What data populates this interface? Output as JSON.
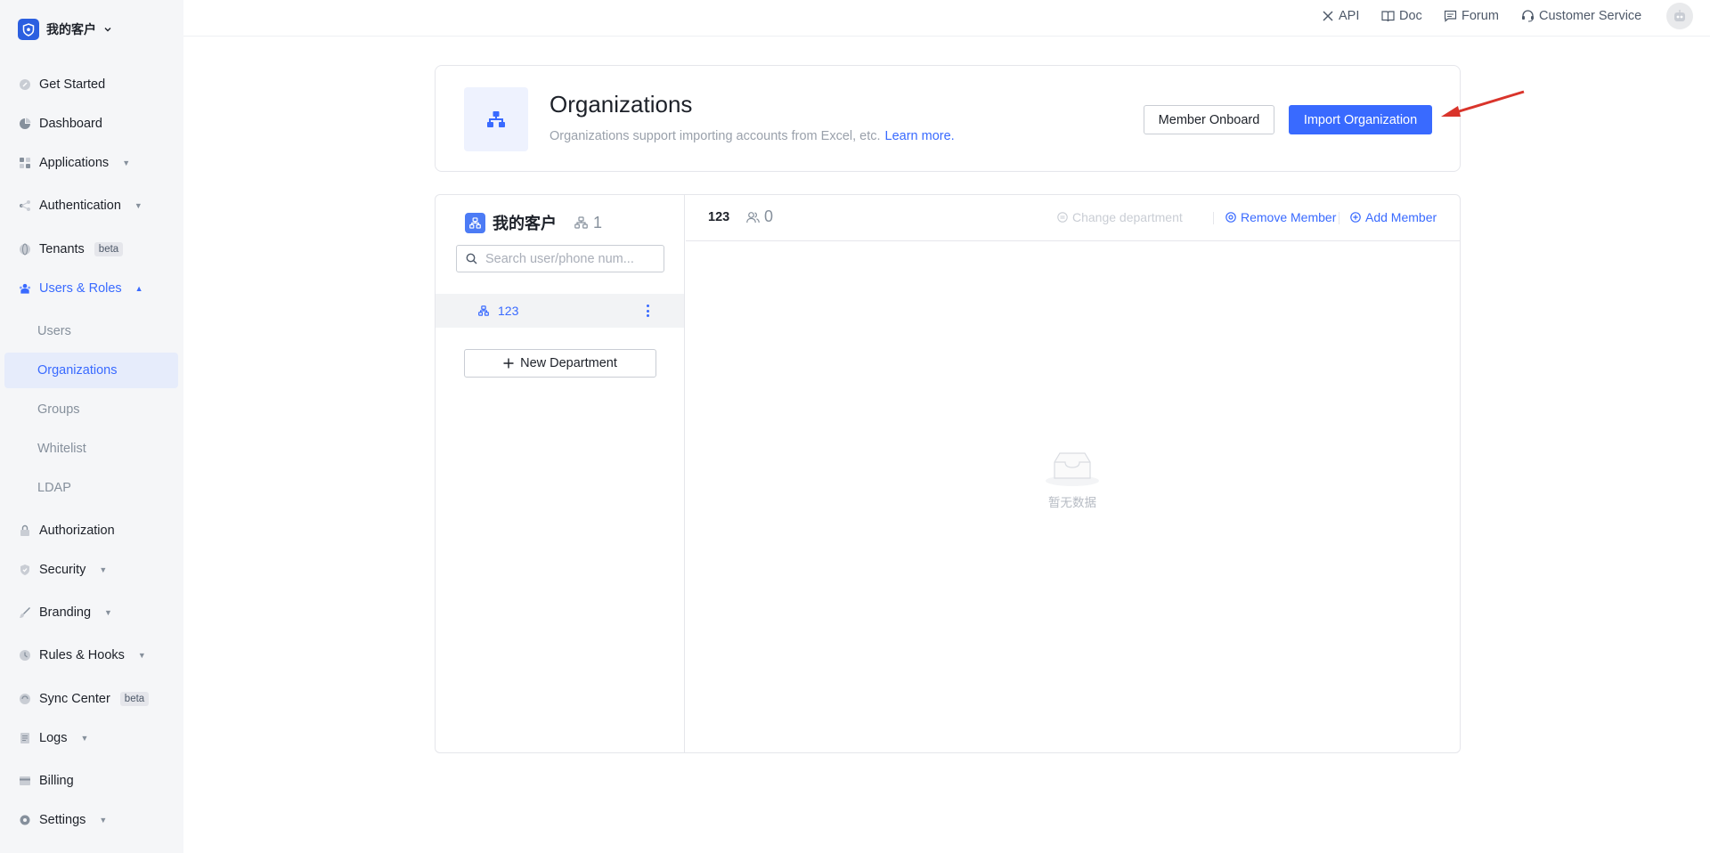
{
  "sidebar": {
    "brand": "我的客户",
    "items": [
      {
        "label": "Get Started"
      },
      {
        "label": "Dashboard"
      },
      {
        "label": "Applications"
      },
      {
        "label": "Authentication"
      },
      {
        "label": "Tenants",
        "badge": "beta"
      },
      {
        "label": "Users & Roles"
      },
      {
        "label": "Authorization"
      },
      {
        "label": "Security"
      },
      {
        "label": "Branding"
      },
      {
        "label": "Rules & Hooks"
      },
      {
        "label": "Sync Center",
        "badge": "beta"
      },
      {
        "label": "Logs"
      },
      {
        "label": "Billing"
      },
      {
        "label": "Settings"
      }
    ],
    "sub_items": [
      {
        "label": "Users"
      },
      {
        "label": "Organizations"
      },
      {
        "label": "Groups"
      },
      {
        "label": "Whitelist"
      },
      {
        "label": "LDAP"
      }
    ]
  },
  "topbar": {
    "api": "API",
    "doc": "Doc",
    "forum": "Forum",
    "support": "Customer Service"
  },
  "header": {
    "title": "Organizations",
    "description": "Organizations support importing accounts from Excel, etc.",
    "learn_more": "Learn more.",
    "member_onboard": "Member Onboard",
    "import_org": "Import Organization"
  },
  "org_panel": {
    "org_name": "我的客户",
    "org_count": "1",
    "search_placeholder": "Search user/phone num...",
    "departments": [
      {
        "name": "123"
      }
    ],
    "new_department": "New Department",
    "selected_department": "123",
    "member_count": "0",
    "actions": {
      "change_department": "Change department",
      "remove_member": "Remove Member",
      "add_member": "Add Member"
    },
    "empty_text": "暂无数据"
  },
  "colors": {
    "accent": "#396aff",
    "sidebar_bg": "#f5f6f8",
    "selected_bg": "#e6ecfb",
    "annotation_arrow": "#d9342b"
  }
}
